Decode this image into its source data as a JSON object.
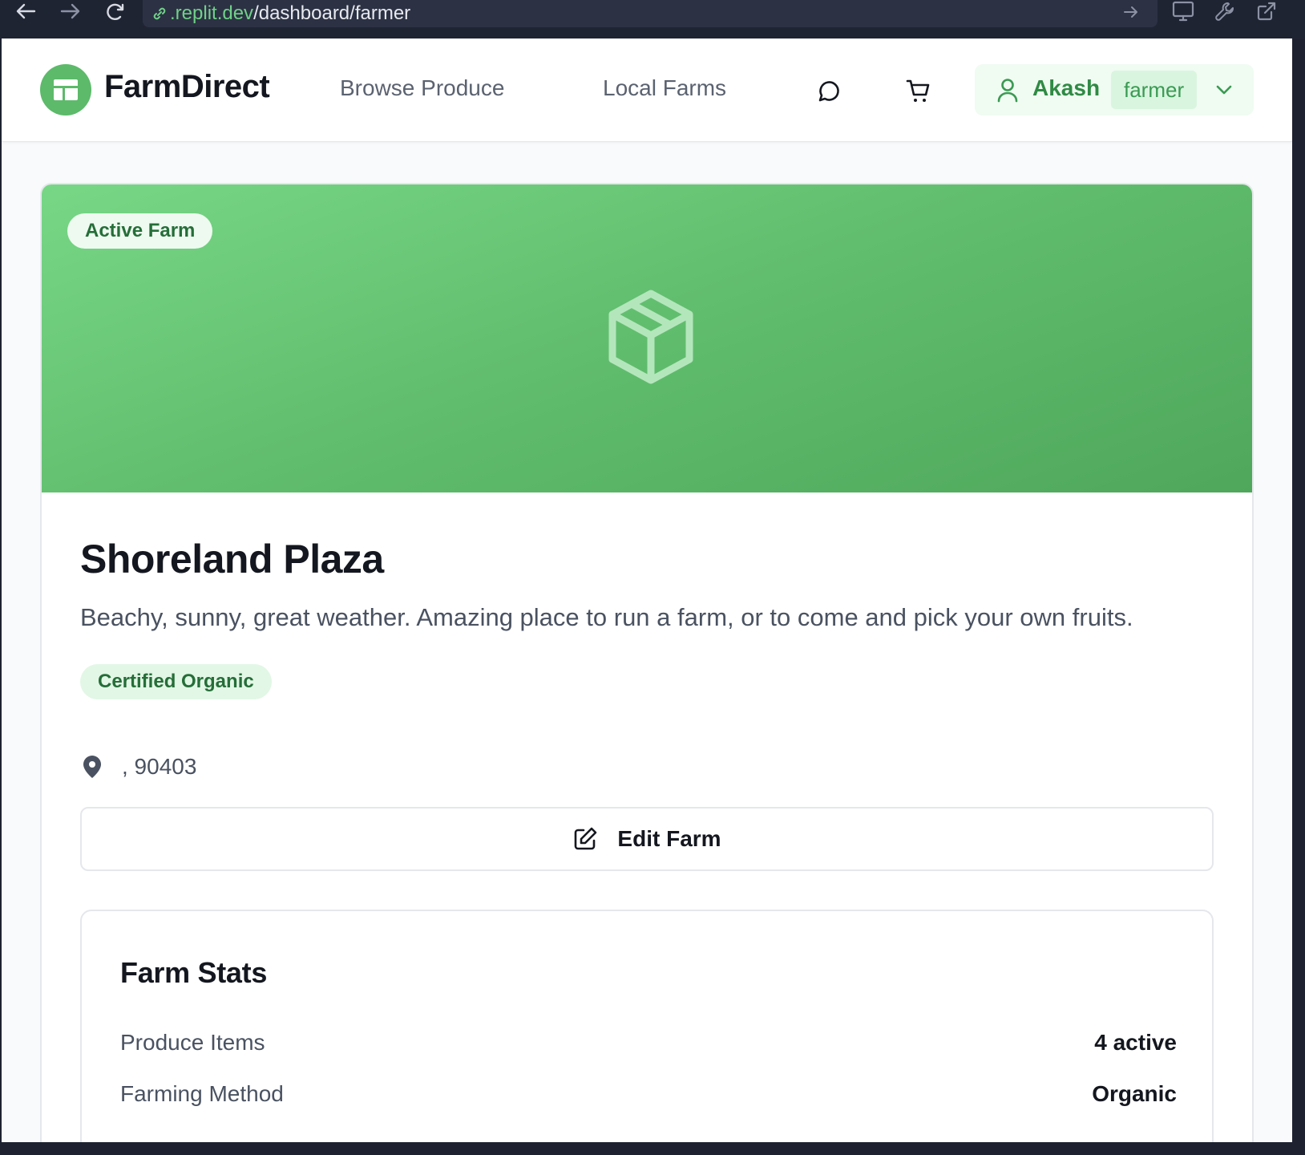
{
  "browser": {
    "url_domain": ".replit.dev",
    "url_path": "/dashboard/farmer"
  },
  "header": {
    "brand": "FarmDirect",
    "nav": [
      {
        "label": "Browse Produce",
        "icon": "none"
      },
      {
        "label": "Local Farms",
        "icon": "none"
      }
    ],
    "icons": [
      "message-icon",
      "cart-icon"
    ],
    "user": {
      "name": "Akash",
      "role": "farmer"
    }
  },
  "farm": {
    "status_badge": "Active Farm",
    "name": "Shoreland Plaza",
    "description": "Beachy, sunny, great weather. Amazing place to run a farm, or to come and pick your own fruits.",
    "certification": "Certified Organic",
    "location": ", 90403",
    "edit_label": "Edit Farm"
  },
  "stats": {
    "title": "Farm Stats",
    "rows": [
      {
        "label": "Produce Items",
        "value": "4 active"
      },
      {
        "label": "Farming Method",
        "value": "Organic"
      }
    ]
  },
  "colors": {
    "brand_green": "#5cba6a",
    "hero_start": "#77d786",
    "hero_end": "#4fa75b",
    "text_dark": "#14171f",
    "text_muted": "#4a5261",
    "accent_text": "#2f8a44"
  }
}
